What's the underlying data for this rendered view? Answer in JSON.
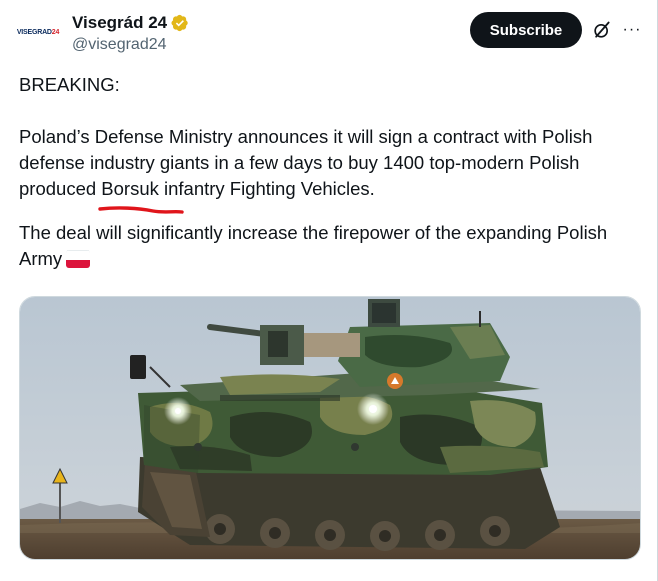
{
  "account": {
    "avatar_text_main": "VISEGRAD",
    "avatar_text_tag": "24",
    "display_name": "Visegrád 24",
    "handle": "@visegrad24",
    "verified_icon": "verified-badge-gold"
  },
  "actions": {
    "subscribe_label": "Subscribe",
    "grok_icon": "grok-icon",
    "more_icon": "more-icon",
    "more_glyph": "···"
  },
  "tweet": {
    "line1": "BREAKING:",
    "paragraph2": "Poland’s Defense Ministry announces it will sign a contract with Polish defense industry giants in a few days to buy 1400 top-modern Polish produced Borsuk infantry Fighting Vehicles.",
    "paragraph3": "The deal will significantly increase the firepower of the expanding Polish Army",
    "flag_icon": "poland-flag-emoji"
  },
  "media": {
    "description_icon": "armored-vehicle-photo"
  },
  "colors": {
    "text": "#0f1419",
    "secondary": "#536471",
    "verified_gold": "#e2b719",
    "underline_red": "#e0151b",
    "flag_red": "#dc143c"
  }
}
